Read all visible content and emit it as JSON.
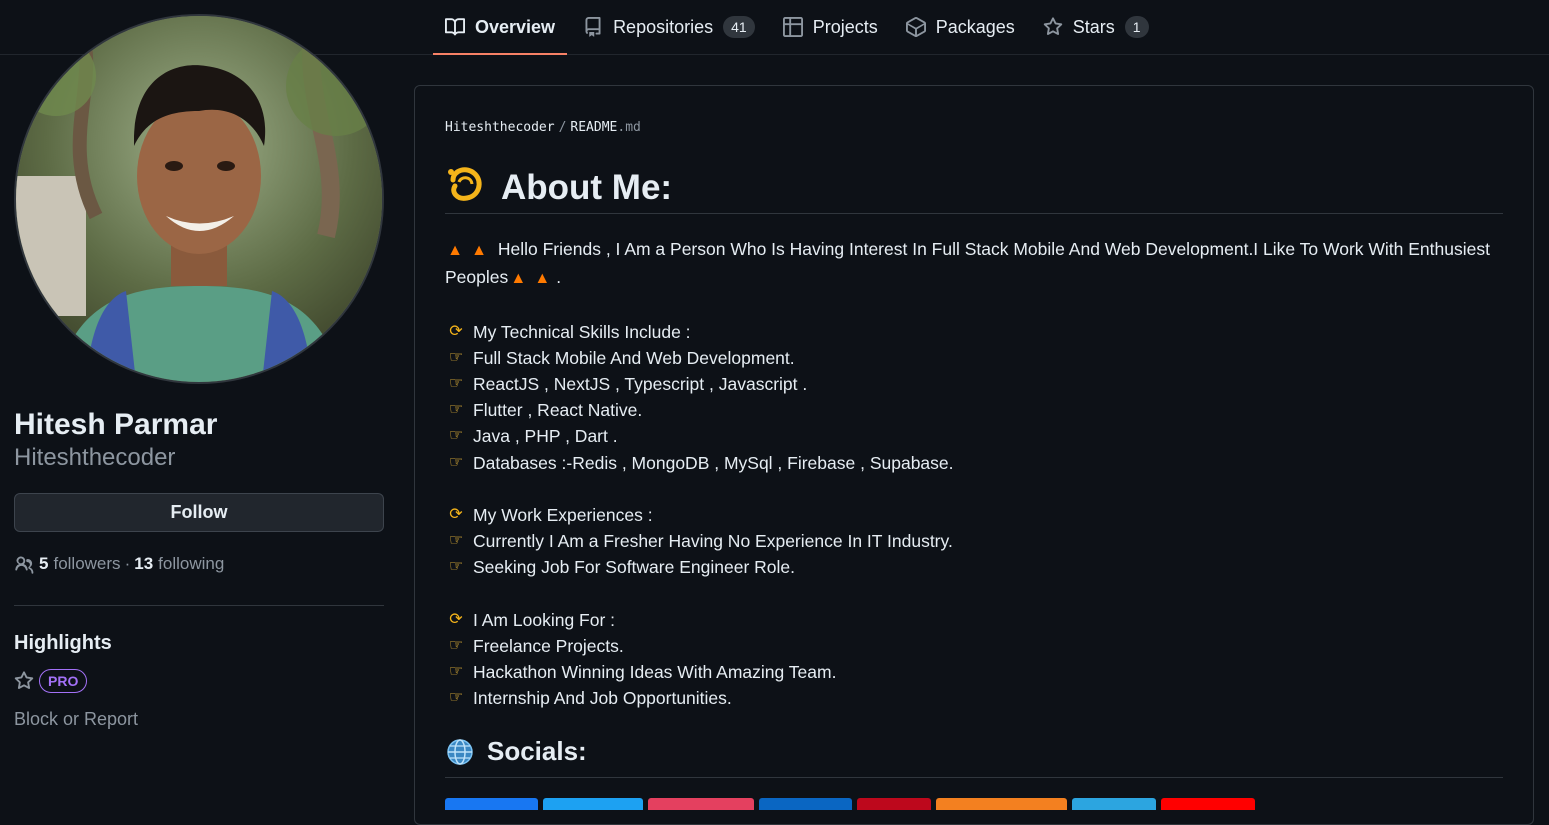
{
  "tabs": [
    {
      "label": "Overview",
      "icon": "book-icon",
      "active": true
    },
    {
      "label": "Repositories",
      "icon": "repo-icon",
      "count": "41"
    },
    {
      "label": "Projects",
      "icon": "table-icon"
    },
    {
      "label": "Packages",
      "icon": "package-icon"
    },
    {
      "label": "Stars",
      "icon": "star-icon",
      "count": "1"
    }
  ],
  "profile": {
    "name": "Hitesh Parmar",
    "username": "Hiteshthecoder",
    "follow_label": "Follow",
    "followers_count": "5",
    "followers_label": "followers",
    "dot": "·",
    "following_count": "13",
    "following_label": "following"
  },
  "highlights": {
    "title": "Highlights",
    "pro_label": "PRO",
    "block_report": "Block or Report"
  },
  "readme": {
    "owner": "Hiteshthecoder",
    "separator": "/",
    "file_base": "README",
    "file_ext": ".md",
    "about_heading": "About Me:",
    "intro": "Hello Friends , I Am a Person Who Is Having Interest In Full Stack Mobile And Web Development.I Like To Work With Enthusiest Peoples",
    "intro_end": ".",
    "skills_title": "My Technical Skills Include :",
    "skills": [
      "Full Stack Mobile And Web Development.",
      "ReactJS , NextJS , Typescript , Javascript .",
      "Flutter , React Native.",
      "Java , PHP , Dart .",
      "Databases :-Redis , MongoDB , MySql , Firebase , Supabase."
    ],
    "work_title": "My Work Experiences :",
    "work": [
      "Currently I Am a Fresher Having No Experience In IT Industry.",
      "Seeking Job For Software Engineer Role."
    ],
    "looking_title": "I Am Looking For :",
    "looking": [
      "Freelance Projects.",
      "Hackathon Winning Ideas With Amazing Team.",
      "Internship And Job Opportunities."
    ],
    "socials_heading": "Socials:"
  },
  "colors": {
    "accent_tab": "#f78166",
    "pro": "#a371f7",
    "badges": [
      "#1877f2",
      "#1da1f2",
      "#e4405f",
      "#0a66c2",
      "#bd081c",
      "#f38020",
      "#2ca5e0",
      "#ff0000"
    ]
  }
}
